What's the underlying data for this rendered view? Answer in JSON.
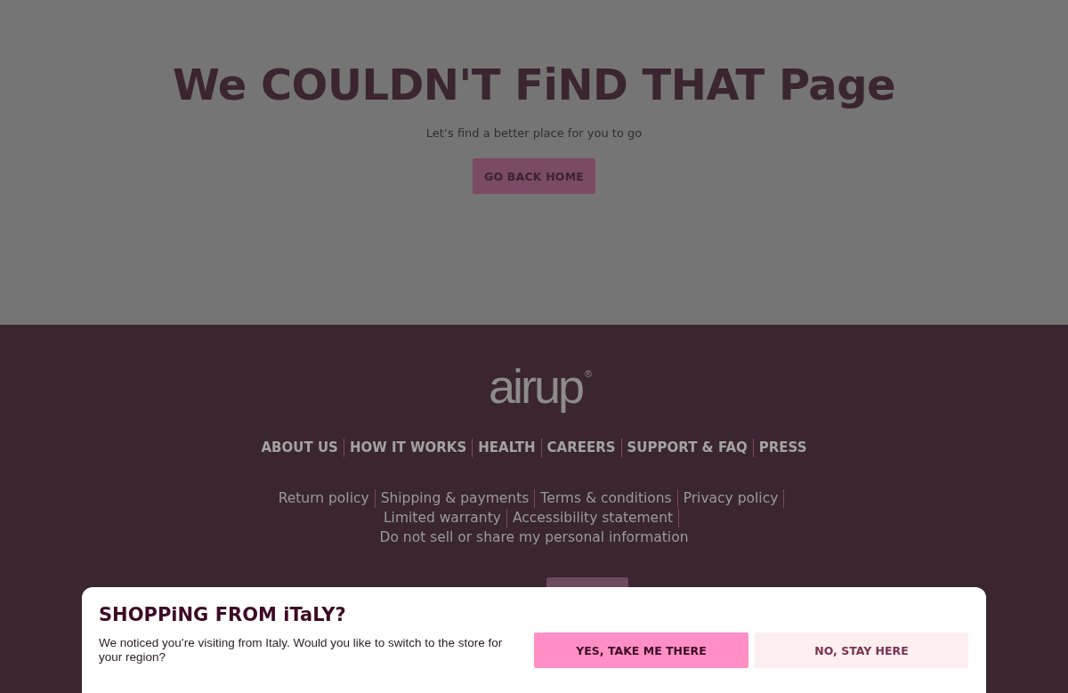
{
  "page": {
    "heading": "We COULDN'T FiND THAT Page",
    "subtitle": "Let’s find a better place for you to go",
    "home_button": "GO BACK HOME"
  },
  "footer": {
    "logo": "airup$^{®}$",
    "nav_links": [
      "ABOUT US",
      "HOW IT WORKS",
      "HEALTH",
      "CAREERS",
      "SUPPORT & FAQ",
      "PRESS"
    ],
    "legal_links": [
      "Return policy",
      "Shipping & payments",
      "Terms & conditions",
      "Privacy policy",
      "Limited warranty",
      "Accessibility statement",
      "Do not sell or share my personal information"
    ]
  },
  "region_dialog": {
    "title": "SHOPPiNG FROM iTaLY?",
    "message": "We noticed you’re visiting from Italy. Would you like to switch to the store for your region?",
    "buttons": [
      {
        "label": "YES, TAKE ME THERE",
        "kind": "primary"
      },
      {
        "label": "NO, STAY HERE",
        "kind": "secondary"
      }
    ]
  }
}
